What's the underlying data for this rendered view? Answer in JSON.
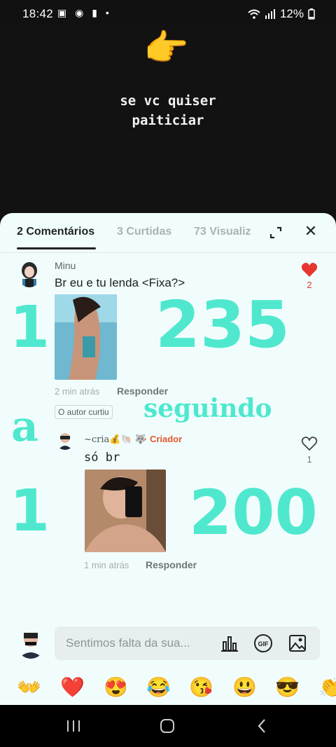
{
  "status_bar": {
    "time": "18:42",
    "left_icons": "▣ ◉ ▮ •",
    "signal": "📶",
    "battery": "12%"
  },
  "story": {
    "emoji": "👉",
    "line1": "se vc quiser",
    "line2": "paiticiar"
  },
  "sheet": {
    "tabs": [
      {
        "label": "2 Comentários",
        "active": true
      },
      {
        "label": "3 Curtidas",
        "active": false
      },
      {
        "label": "73 Visualiz",
        "active": false
      }
    ],
    "close": "✕"
  },
  "comments": [
    {
      "username": "Minu",
      "text": "Br eu e tu lenda <Fixa?>",
      "time": "2 min atrás",
      "reply": "Responder",
      "likes": "2",
      "liked": true
    }
  ],
  "author_liked": "O autor curtiu",
  "replies": [
    {
      "username": "~cria💰🐚 🐺",
      "badge": "· Criador",
      "text": "só br",
      "time": "1 min atrás",
      "reply": "Responder",
      "likes": "1",
      "liked": false
    }
  ],
  "overlay": {
    "n1": "1",
    "n235": "235",
    "a": "a",
    "seguindo": "seguindo",
    "n1b": "1",
    "n200": "200"
  },
  "input": {
    "placeholder": "Sentimos falta da sua..."
  },
  "emoji_row": [
    "👐",
    "❤️",
    "😍",
    "😂",
    "😘",
    "😃",
    "😎",
    "👏"
  ],
  "colors": {
    "accent_overlay": "#4fe8cf",
    "heart": "#e7352f",
    "creator": "#e8542f"
  }
}
